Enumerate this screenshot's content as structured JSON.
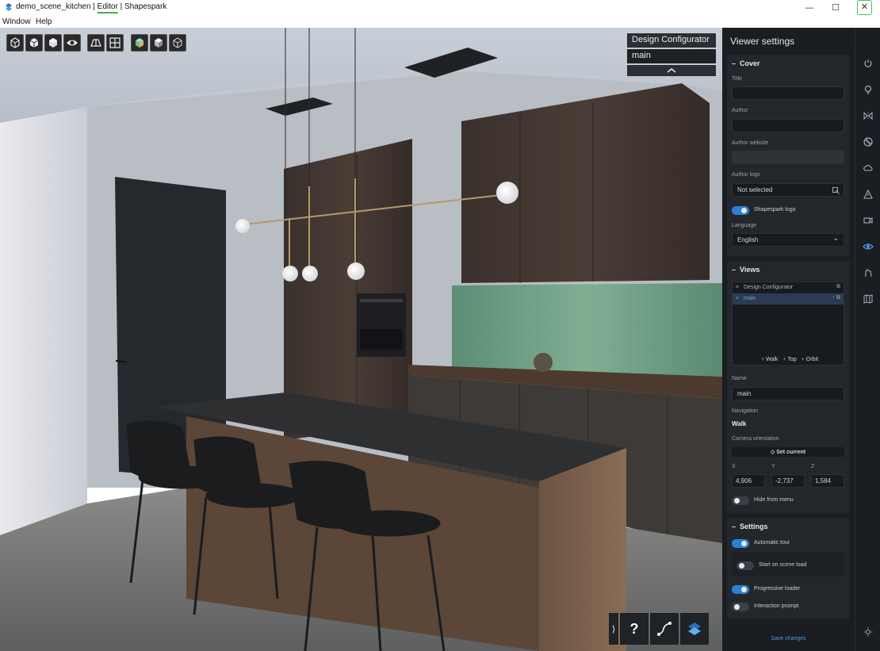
{
  "window": {
    "title_app": "demo_scene_kitchen",
    "title_sep1": " | ",
    "title_editor": "Editor",
    "title_sep2": " | ",
    "title_brand": "Shapespark",
    "minimize_glyph": "—",
    "maximize_glyph": "☐",
    "close_glyph": "✕"
  },
  "menu": {
    "items": [
      "Window",
      "Help"
    ]
  },
  "viewport_toolbar": {
    "icons": [
      "cube-front-icon",
      "cube-side-icon",
      "cube-top-icon",
      "eye-icon",
      "layout-split-icon",
      "layout-grid-icon",
      "material-color-icon",
      "material-shaded-icon",
      "material-wire-icon"
    ]
  },
  "configurator": {
    "items": [
      "Design Configurator",
      "main"
    ],
    "collapse_glyph": "︿"
  },
  "bottom_bar": {
    "expand_glyph": "⟩",
    "help_glyph": "?"
  },
  "panel": {
    "header": "Viewer settings",
    "cover": {
      "title": "Cover",
      "collapse": "–",
      "title_label": "Title",
      "title_value": "",
      "author_label": "Author",
      "author_value": "",
      "website_label": "Author website",
      "website_value": "",
      "logo_label": "Author logo",
      "logo_value": "Not selected",
      "shapespark_logo_label": "Shapespark logo",
      "language_label": "Language",
      "language_value": "English",
      "language_chevron": "⌄"
    },
    "views": {
      "title": "Views",
      "collapse": "–",
      "list": [
        {
          "name": "Design Configurator",
          "selected": false
        },
        {
          "name": "main",
          "selected": true
        }
      ],
      "add_walk": "Walk",
      "add_top": "Top",
      "add_orbit": "Orbit",
      "plus": "+",
      "name_label": "Name",
      "name_value": "main",
      "navigation_label": "Navigation",
      "navigation_value": "Walk",
      "camera_label": "Camera orientation",
      "set_current": "Set current",
      "x_label": "X",
      "y_label": "Y",
      "z_label": "Z",
      "x_value": "4,906",
      "y_value": "-2,737",
      "z_value": "1,584",
      "hide_label": "Hide from menu"
    },
    "settings": {
      "title": "Settings",
      "collapse": "–",
      "auto_tour": "Automatic tour",
      "start_on_load": "Start on scene load",
      "progressive_loader": "Progressive loader",
      "interaction_prompt": "Interaction prompt"
    },
    "save_label": "Save changes"
  },
  "toggles": {
    "shapespark_logo": true,
    "hide_from_menu": false,
    "automatic_tour": true,
    "start_on_load": false,
    "progressive_loader": true,
    "interaction_prompt": false
  },
  "colors": {
    "accent": "#2d7fd3",
    "panel_bg": "#1a1d21",
    "section_bg": "#23272c",
    "active_tab_underline": "#3cb44b"
  }
}
